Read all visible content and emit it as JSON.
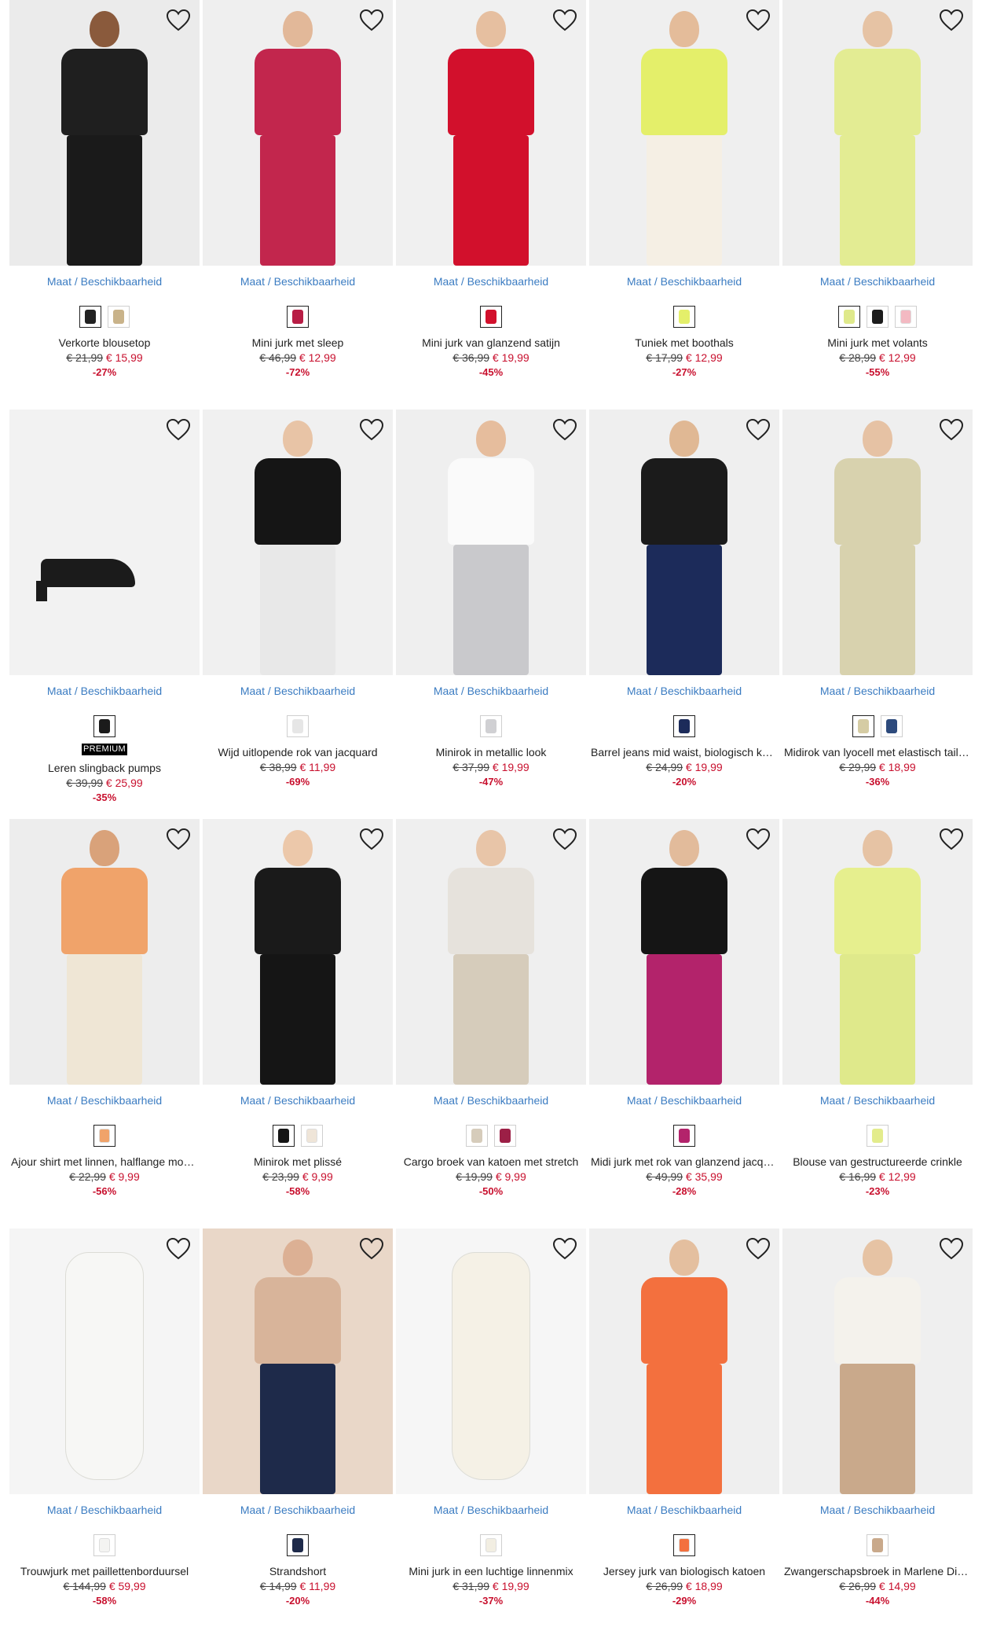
{
  "maat_label": "Maat / Beschikbaarheid",
  "products": [
    {
      "name": "Verkorte blousetop",
      "old": "€ 21,99",
      "new": "€ 15,99",
      "disc": "-27%",
      "bg": "#ebebeb",
      "top": "#1f1f1f",
      "bottom": "#1a1a1a",
      "skin": "#8a5a3c",
      "swatches": [
        {
          "c": "#222222",
          "sel": true
        },
        {
          "c": "#c9b38a",
          "sel": false
        }
      ]
    },
    {
      "name": "Mini jurk met sleep",
      "old": "€ 46,99",
      "new": "€ 12,99",
      "disc": "-72%",
      "bg": "#efefef",
      "top": "#c2264d",
      "bottom": "#c2264d",
      "skin": "#e2b899",
      "swatches": [
        {
          "c": "#b81d45",
          "sel": true
        }
      ]
    },
    {
      "name": "Mini jurk van glanzend satijn",
      "old": "€ 36,99",
      "new": "€ 19,99",
      "disc": "-45%",
      "bg": "#f0f0f0",
      "top": "#d2102c",
      "bottom": "#d2102c",
      "skin": "#e6bfa0",
      "swatches": [
        {
          "c": "#d2102c",
          "sel": true
        }
      ]
    },
    {
      "name": "Tuniek met boothals",
      "old": "€ 17,99",
      "new": "€ 12,99",
      "disc": "-27%",
      "bg": "#efefef",
      "top": "#e4ef6a",
      "bottom": "#f5efe4",
      "skin": "#e4bc9a",
      "swatches": [
        {
          "c": "#e4ef6a",
          "sel": true
        }
      ]
    },
    {
      "name": "Mini jurk met volants",
      "old": "€ 28,99",
      "new": "€ 12,99",
      "disc": "-55%",
      "bg": "#eeeeee",
      "top": "#e3ec93",
      "bottom": "#e3ec93",
      "skin": "#e6c3a4",
      "swatches": [
        {
          "c": "#dfe98b",
          "sel": true
        },
        {
          "c": "#1c1c1c",
          "sel": false
        },
        {
          "c": "#f3b9c2",
          "sel": false
        }
      ]
    },
    {
      "name": "Leren slingback pumps",
      "old": "€ 39,99",
      "new": "€ 25,99",
      "disc": "-35%",
      "bg": "#f2f2f2",
      "top": "",
      "bottom": "#1b1b1b",
      "skin": "",
      "shoe": true,
      "premium": "PREMIUM",
      "swatches": [
        {
          "c": "#1b1b1b",
          "sel": true
        }
      ]
    },
    {
      "name": "Wijd uitlopende rok van jacquard",
      "old": "€ 38,99",
      "new": "€ 11,99",
      "disc": "-69%",
      "bg": "#f0f0f0",
      "top": "#151515",
      "bottom": "#e8e8e8",
      "skin": "#e8c4a6",
      "swatches": [
        {
          "c": "#e6e6e6",
          "sel": false
        }
      ]
    },
    {
      "name": "Minirok in metallic look",
      "old": "€ 37,99",
      "new": "€ 19,99",
      "disc": "-47%",
      "bg": "#efefef",
      "top": "#fafafa",
      "bottom": "#c9c9cc",
      "skin": "#e6bd9d",
      "swatches": [
        {
          "c": "#d0d0d3",
          "sel": false
        }
      ]
    },
    {
      "name": "Barrel jeans mid waist, biologisch katoen",
      "old": "€ 24,99",
      "new": "€ 19,99",
      "disc": "-20%",
      "bg": "#efefef",
      "top": "#1b1b1b",
      "bottom": "#1c2b5a",
      "skin": "#e0b894",
      "swatches": [
        {
          "c": "#1c2b5a",
          "sel": true
        }
      ]
    },
    {
      "name": "Midirok van lyocell met elastisch taillebandje",
      "old": "€ 29,99",
      "new": "€ 18,99",
      "disc": "-36%",
      "bg": "#efefef",
      "top": "#d8d2ae",
      "bottom": "#d8d2ae",
      "skin": "#e6c2a4",
      "swatches": [
        {
          "c": "#d5cca4",
          "sel": true
        },
        {
          "c": "#2d4a7c",
          "sel": false
        }
      ]
    },
    {
      "name": "Ajour shirt met linnen, halflange mouwen",
      "old": "€ 22,99",
      "new": "€ 9,99",
      "disc": "-56%",
      "bg": "#ededed",
      "top": "#f0a36a",
      "bottom": "#efe6d5",
      "skin": "#d9a27a",
      "swatches": [
        {
          "c": "#f0a36a",
          "sel": true
        }
      ]
    },
    {
      "name": "Minirok met plissé",
      "old": "€ 23,99",
      "new": "€ 9,99",
      "disc": "-58%",
      "bg": "#f0f0f0",
      "top": "#1a1a1a",
      "bottom": "#151515",
      "skin": "#ecc8aa",
      "swatches": [
        {
          "c": "#151515",
          "sel": true
        },
        {
          "c": "#efe5d8",
          "sel": false
        }
      ]
    },
    {
      "name": "Cargo broek van katoen met stretch",
      "old": "€ 19,99",
      "new": "€ 9,99",
      "disc": "-50%",
      "bg": "#efefef",
      "top": "#e6e2dc",
      "bottom": "#d6ccbb",
      "skin": "#e8c5a8",
      "swatches": [
        {
          "c": "#d6ccbb",
          "sel": false
        },
        {
          "c": "#9c1f46",
          "sel": false
        }
      ]
    },
    {
      "name": "Midi jurk met rok van glanzend jacquard",
      "old": "€ 49,99",
      "new": "€ 35,99",
      "disc": "-28%",
      "bg": "#efefef",
      "top": "#151515",
      "bottom": "#b3236b",
      "skin": "#e2bb9b",
      "swatches": [
        {
          "c": "#b3236b",
          "sel": true
        }
      ]
    },
    {
      "name": "Blouse van gestructureerde crinkle",
      "old": "€ 16,99",
      "new": "€ 12,99",
      "disc": "-23%",
      "bg": "#efefef",
      "top": "#e6ef8e",
      "bottom": "#dfe98b",
      "skin": "#e6c3a4",
      "swatches": [
        {
          "c": "#e3ec8c",
          "sel": false
        }
      ]
    },
    {
      "name": "Trouwjurk met paillettenborduursel",
      "old": "€ 144,99",
      "new": "€ 59,99",
      "disc": "-58%",
      "bg": "#f5f5f5",
      "top": "#f7f7f5",
      "bottom": "#f7f7f5",
      "skin": "",
      "flat": true,
      "swatches": [
        {
          "c": "#f4f4f2",
          "sel": false
        }
      ]
    },
    {
      "name": "Strandshort",
      "old": "€ 14,99",
      "new": "€ 11,99",
      "disc": "-20%",
      "bg": "#e9d7c8",
      "top": "#d8b49a",
      "bottom": "#1e2a4a",
      "skin": "#dcb094",
      "swatches": [
        {
          "c": "#1e2a4a",
          "sel": true
        }
      ]
    },
    {
      "name": "Mini jurk in een luchtige linnenmix",
      "old": "€ 31,99",
      "new": "€ 19,99",
      "disc": "-37%",
      "bg": "#f6f6f6",
      "top": "#f5f1e6",
      "bottom": "#f5f1e6",
      "skin": "",
      "flat": true,
      "swatches": [
        {
          "c": "#f2eee2",
          "sel": false
        }
      ]
    },
    {
      "name": "Jersey jurk van biologisch katoen",
      "old": "€ 26,99",
      "new": "€ 18,99",
      "disc": "-29%",
      "bg": "#efefef",
      "top": "#f3703e",
      "bottom": "#f3703e",
      "skin": "#e4bf9f",
      "swatches": [
        {
          "c": "#f3703e",
          "sel": true
        }
      ]
    },
    {
      "name": "Zwangerschapsbroek in Marlene Dietrich stijl",
      "old": "€ 26,99",
      "new": "€ 14,99",
      "disc": "-44%",
      "bg": "#efefef",
      "top": "#f4f2ec",
      "bottom": "#c9a98b",
      "skin": "#e6c3a4",
      "swatches": [
        {
          "c": "#c9a98b",
          "sel": false
        }
      ]
    }
  ]
}
